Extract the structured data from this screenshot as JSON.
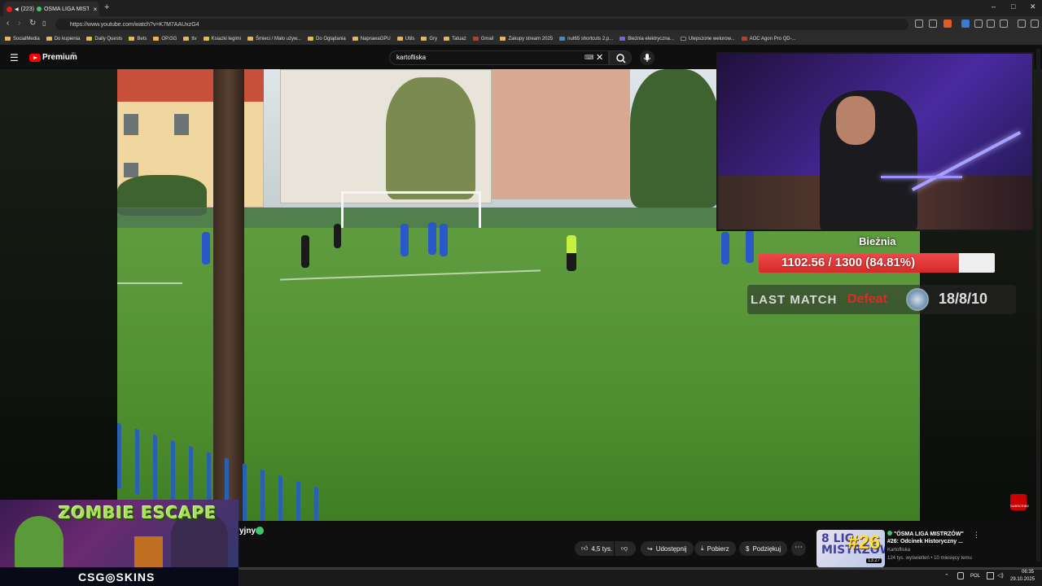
{
  "browser": {
    "tab_count": "(223)",
    "tab_title": "ÓSMA LIGA MISTRZ",
    "close_tab": "×",
    "new_tab": "+",
    "url": "https://www.youtube.com/watch?v=K7M7AAUxzG4",
    "window_controls": [
      "–",
      "□",
      "✕"
    ],
    "bookmarks": [
      "SocialMedia",
      "Do kupienia",
      "Daily Quests",
      "Bets",
      "OP.GG",
      "ttv",
      "Ksiazki legimi",
      "Śmieci / Mało używ...",
      "Do Oglądania",
      "NaprawaGPU",
      "Utils",
      "Gry",
      "Tatuaż",
      "Gmail",
      "Zakupy stream 2025",
      "nut65 shortcuts 2.p...",
      "Bieżnia elektryczna...",
      "Ulepszone welurow...",
      "AOC Agon Pro QD-..."
    ]
  },
  "youtube": {
    "brand": "Premium",
    "region": "PL",
    "search_value": "kartofliska",
    "clear": "✕",
    "hamburger": "☰"
  },
  "overlay": {
    "treadmill_title": "Bieżnia",
    "treadmill_text": "1102.56 / 1300 (84.81%)",
    "treadmill_progress": 0.8481,
    "last_match_label": "LAST MATCH",
    "last_match_result": "Defeat",
    "last_match_score": "18/8/10",
    "subscribe_badge": "SUBSCRIBE"
  },
  "promo": {
    "zombie_title": "ZOMBIE ESCAPE",
    "sponsor": "CSG◎SKINS"
  },
  "video_info": {
    "channel_fragment": "yjny",
    "likes": "4,5 tys.",
    "share": "Udostępnij",
    "download": "Pobierz",
    "thanks": "Podziękuj",
    "more": "⋯"
  },
  "recommended": {
    "title_line1": "\"ÓSMA LIGA MISTRZÓW\"",
    "title_line2": "#26: Odcinek Historyczny ...",
    "channel": "Kartofliska",
    "meta": "124 tys. wyświetleń • 10 miesięcy temu",
    "thumb_text": "8 LIG MISTRZÓW",
    "thumb_number": "#26",
    "duration": "13:27",
    "menu": "⋮"
  },
  "taskbar": {
    "language": "POL",
    "time": "06:35",
    "date": "29.10.2025"
  },
  "colors": {
    "accent_red": "#ff0000",
    "treadmill_fill": "#e03a3a",
    "defeat": "#e02828",
    "zombie_green": "#a8e05a"
  }
}
